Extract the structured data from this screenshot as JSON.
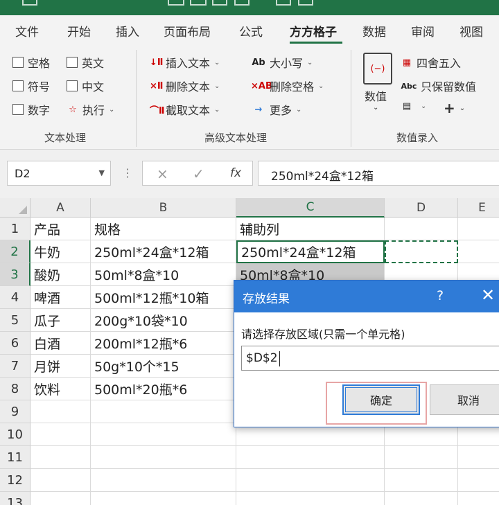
{
  "menu": {
    "tabs": [
      "文件",
      "开始",
      "插入",
      "页面布局",
      "公式",
      "方方格子",
      "数据",
      "审阅",
      "视图"
    ],
    "active_tab": "方方格子"
  },
  "ribbon": {
    "text_processing": {
      "options": [
        "空格",
        "英文",
        "符号",
        "中文",
        "数字"
      ],
      "execute_label": "执行",
      "group_label": "文本处理"
    },
    "advanced": {
      "insert_text": "插入文本",
      "delete_text": "删除文本",
      "extract_text": "截取文本",
      "case_label": "大小写",
      "delete_spaces": "删除空格",
      "more_label": "更多",
      "group_label": "高级文本处理"
    },
    "numeric": {
      "value_label": "数值",
      "round_label": "四舍五入",
      "keep_value_label": "只保留数值",
      "plus_label": "+",
      "group_label": "数值录入"
    }
  },
  "formula_bar": {
    "name_box": "D2",
    "cancel": "×",
    "enter": "✓",
    "fx": "fx",
    "content": "250ml*24盒*12箱"
  },
  "sheet": {
    "columns": [
      "A",
      "B",
      "C",
      "D",
      "E"
    ],
    "rows": [
      [
        "产品",
        "规格",
        "辅助列",
        ""
      ],
      [
        "牛奶",
        "250ml*24盒*12箱",
        "250ml*24盒*12箱",
        ""
      ],
      [
        "酸奶",
        "50ml*8盒*10",
        "50ml*8盒*10",
        ""
      ],
      [
        "啤酒",
        "500ml*12瓶*10箱",
        "",
        ""
      ],
      [
        "瓜子",
        "200g*10袋*10",
        "",
        ""
      ],
      [
        "白酒",
        "200ml*12瓶*6",
        "",
        ""
      ],
      [
        "月饼",
        "50g*10个*15",
        "",
        ""
      ],
      [
        "饮料",
        "500ml*20瓶*6",
        "",
        ""
      ],
      [
        "",
        "",
        "",
        ""
      ],
      [
        "",
        "",
        "",
        ""
      ],
      [
        "",
        "",
        "",
        ""
      ],
      [
        "",
        "",
        "",
        ""
      ],
      [
        "",
        "",
        "",
        ""
      ]
    ],
    "row_numbers": [
      "1",
      "2",
      "3",
      "4",
      "5",
      "6",
      "7",
      "8",
      "9",
      "10",
      "11",
      "12",
      "13"
    ]
  },
  "dialog": {
    "title": "存放结果",
    "help": "?",
    "close": "✕",
    "prompt": "请选择存放区域(只需一个单元格)",
    "value": "$D$2",
    "ok_label": "确定",
    "cancel_label": "取消",
    "accent": "#2f7bd7"
  },
  "colors": {
    "excel_green": "#217346"
  }
}
